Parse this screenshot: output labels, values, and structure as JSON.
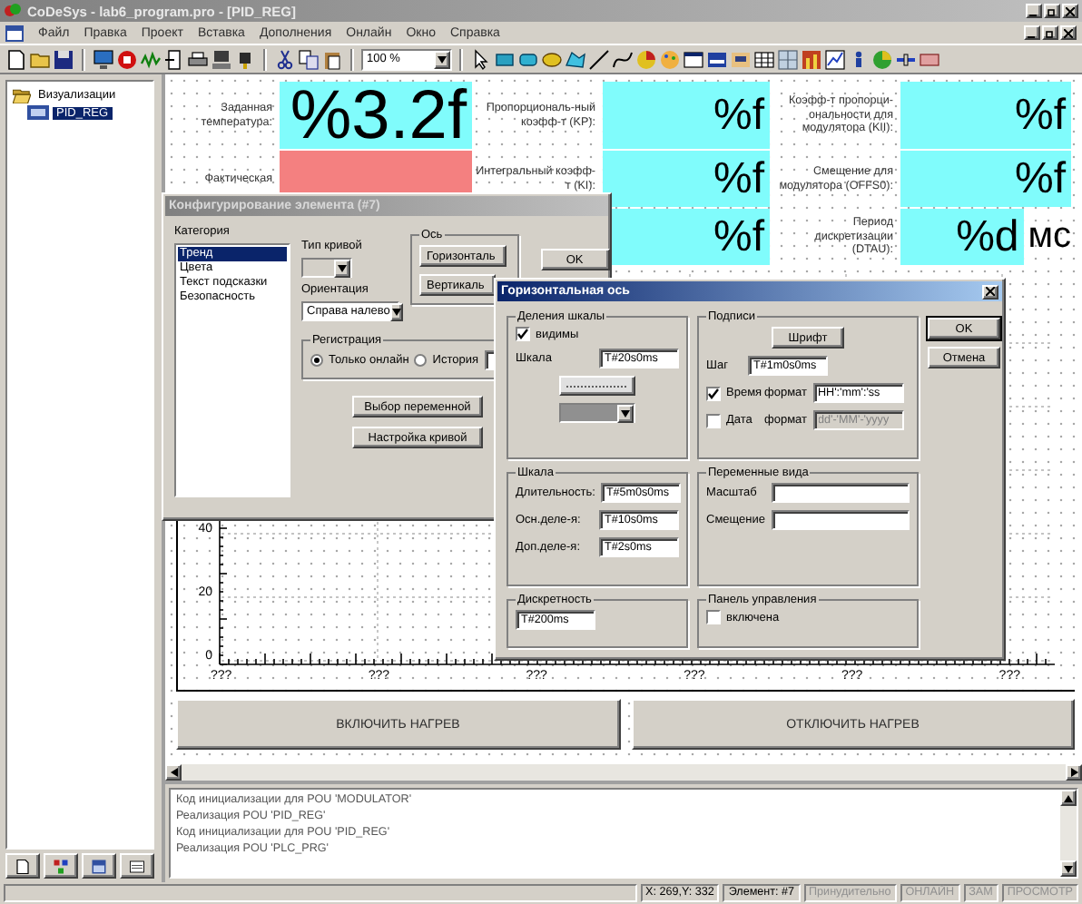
{
  "window": {
    "title": "CoDeSys - lab6_program.pro - [PID_REG]"
  },
  "menu": [
    "Файл",
    "Правка",
    "Проект",
    "Вставка",
    "Дополнения",
    "Онлайн",
    "Окно",
    "Справка"
  ],
  "toolbar": {
    "zoom": "100 %"
  },
  "tree": [
    {
      "label": "Визуализации",
      "expanded": true,
      "children": [
        {
          "label": "PID_REG",
          "selected": true
        }
      ]
    }
  ],
  "visualization": {
    "rows": [
      {
        "cells": [
          {
            "label": "Заданная температура:",
            "value": "%3.2f",
            "kind": "large",
            "color": "#80fcfc"
          },
          {
            "label": "Пропорциональ-ный коэфф-т (KP):",
            "value": "%f",
            "kind": "normal",
            "color": "#80fcfc"
          },
          {
            "label": "Коэфф-т пропорци-ональности для модулятора (KII):",
            "value": "%f",
            "kind": "normal",
            "color": "#80fcfc"
          }
        ]
      },
      {
        "cells": [
          {
            "label": "Фактическая",
            "kind": "normal",
            "color": "#f48080"
          },
          {
            "label": "Интегральный коэфф-т (KI):",
            "value": "%f",
            "kind": "normal",
            "color": "#80fcfc"
          },
          {
            "label": "Смещение для модулятора (OFFS0):",
            "value": "%f",
            "kind": "normal",
            "color": "#80fcfc"
          }
        ]
      },
      {
        "cells": [
          "",
          {
            "value": "%f",
            "kind": "normal",
            "color": "#80fcfc"
          },
          {
            "label": "Период дискретизации (DTAU):",
            "value": "%d",
            "unit": "мс",
            "kind": "normal",
            "color": "#80fcfc"
          }
        ]
      }
    ],
    "trend": {
      "y_labels": [
        "40",
        "20",
        "0"
      ],
      "x_labels": [
        "???",
        "???",
        "???",
        "???",
        "???",
        "???"
      ]
    },
    "buttons": [
      "ВКЛЮЧИТЬ НАГРЕВ",
      "ОТКЛЮЧИТЬ НАГРЕВ"
    ]
  },
  "messages": [
    "Код инициализации для POU 'MODULATOR'",
    "Реализация POU 'PID_REG'",
    "Код инициализации для POU 'PID_REG'",
    "Реализация POU 'PLC_PRG'"
  ],
  "status_bar": {
    "position": "X: 269,Y: 332",
    "element": "Элемент: #7",
    "indicators": [
      {
        "label": "Принудительно",
        "active": false
      },
      {
        "label": "ОНЛАЙН",
        "active": false
      },
      {
        "label": "ЗАМ",
        "active": false
      },
      {
        "label": "ПРОСМОТР",
        "active": false
      }
    ]
  },
  "config_dialog": {
    "title": "Конфигурирование элемента (#7)",
    "active": false,
    "category_label": "Категория",
    "categories": [
      {
        "label": "Тренд",
        "selected": true
      },
      {
        "label": "Цвета",
        "selected": false
      },
      {
        "label": "Текст подсказки",
        "selected": false
      },
      {
        "label": "Безопасность",
        "selected": false
      }
    ],
    "curve_type": {
      "label": "Тип кривой",
      "disabled": true
    },
    "orientation": {
      "label": "Ориентация",
      "value": "Справа налево"
    },
    "axis": {
      "title": "Ось",
      "buttons": [
        "Горизонталь",
        "Вертикаль"
      ]
    },
    "registration": {
      "title": "Регистрация",
      "options": [
        {
          "label": "Только онлайн",
          "selected": true
        },
        {
          "label": "История",
          "selected": false
        }
      ]
    },
    "buttons": [
      "Выбор переменной",
      "Настройка кривой"
    ],
    "ok": "OK"
  },
  "axis_dialog": {
    "title": "Горизонтальная ось",
    "active": true,
    "divisions": {
      "title": "Деления шкалы",
      "visible": {
        "label": "видимы",
        "checked": true
      },
      "scale_label": "Шкала",
      "scale": "T#20s0ms"
    },
    "labels": {
      "title": "Подписи",
      "font_button": "Шрифт",
      "step_label": "Шаг",
      "step": "T#1m0s0ms",
      "options": [
        {
          "label": "Время",
          "checked": true,
          "format_label": "формат",
          "format": "HH':'mm':'ss"
        },
        {
          "label": "Дата",
          "checked": false,
          "format_label": "формат",
          "format": "dd'-'MM'-'yyyy"
        }
      ]
    },
    "scale": {
      "title": "Шкала",
      "rows": [
        {
          "label": "Длительность:",
          "value": "T#5m0s0ms"
        },
        {
          "label": "Осн.деле-я:",
          "value": "T#10s0ms"
        },
        {
          "label": "Доп.деле-я:",
          "value": "T#2s0ms"
        }
      ]
    },
    "view_variables": {
      "title": "Переменные вида",
      "rows": [
        {
          "label": "Масштаб"
        },
        {
          "label": "Смещение"
        }
      ]
    },
    "resolution": {
      "title": "Дискретность",
      "value": "T#200ms"
    },
    "control_panel": {
      "title": "Панель управления",
      "enabled": {
        "label": "включена",
        "checked": false
      }
    },
    "buttons": [
      {
        "label": "OK",
        "default": true
      },
      {
        "label": "Отмена",
        "default": false
      }
    ]
  }
}
